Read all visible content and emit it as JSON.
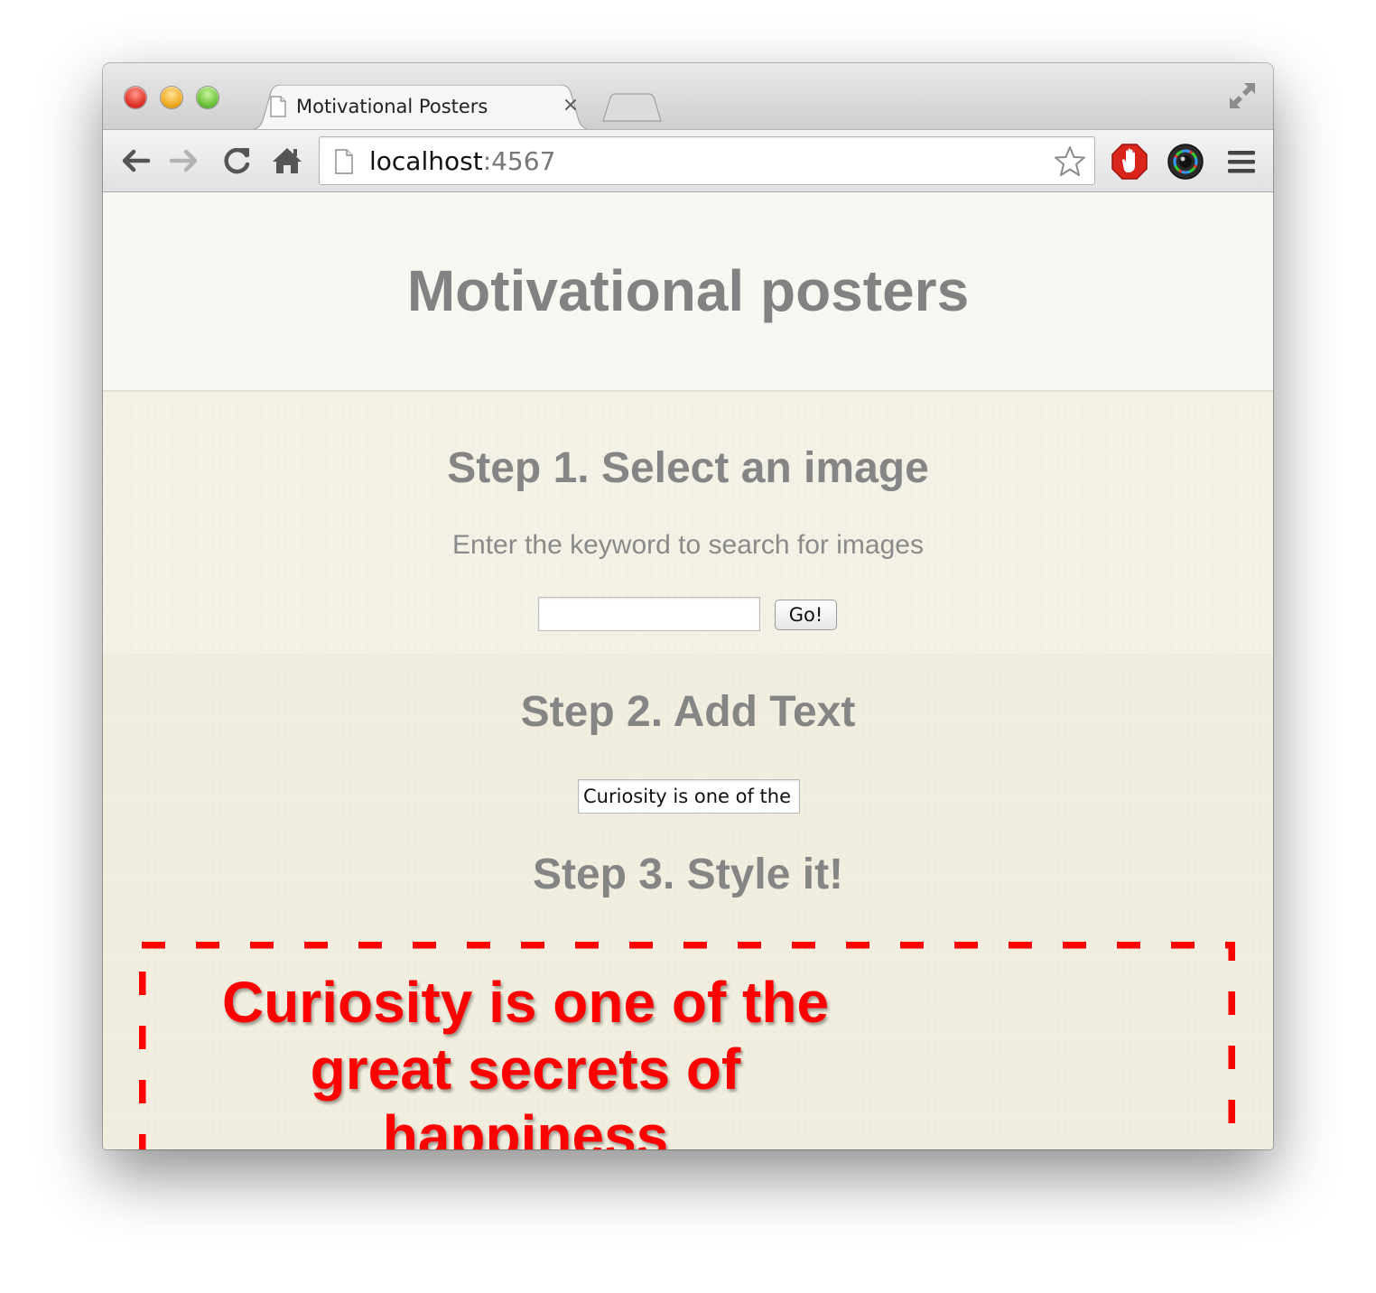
{
  "browser": {
    "tab": {
      "title": "Motivational Posters",
      "close_glyph": "×",
      "favicon": "page-icon"
    },
    "new_tab": "new-tab-icon",
    "fullscreen": "fullscreen-icon",
    "toolbar": {
      "back": "back-arrow-icon",
      "forward": "forward-arrow-icon",
      "reload": "reload-icon",
      "home": "home-icon"
    },
    "omnibox": {
      "host": "localhost",
      "port": ":4567",
      "bookmark": "star-icon"
    },
    "extensions": [
      "adblock-stop-hand-icon",
      "color-picker-lens-icon"
    ],
    "menu": "hamburger-menu-icon"
  },
  "page": {
    "title": "Motivational posters",
    "step1": {
      "heading": "Step 1. Select an image",
      "description": "Enter the keyword to search for images",
      "search_value": "",
      "button_label": "Go!"
    },
    "step2": {
      "heading": "Step 2. Add Text",
      "text_value": "Curiosity is one of the"
    },
    "step3": {
      "heading": "Step 3. Style it!"
    },
    "poster": {
      "lines": [
        "Curiosity is one of the",
        "great secrets of",
        "happiness"
      ],
      "text_color": "#ff0000",
      "border_color": "#ff0000"
    }
  }
}
